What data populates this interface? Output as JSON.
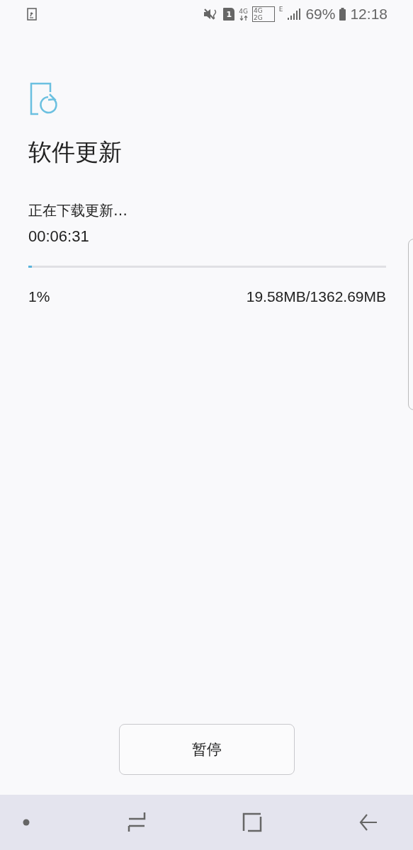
{
  "status_bar": {
    "sim_slot": "1",
    "network_type": "4G",
    "dual_top": "4G",
    "dual_bottom": "2G",
    "data_type": "E",
    "battery": "69%",
    "time": "12:18"
  },
  "title": "软件更新",
  "status_text": "正在下载更新…",
  "elapsed": "00:06:31",
  "progress": {
    "level": 0.01,
    "percent": "1%",
    "size": "19.58MB/1362.69MB"
  },
  "button": "暂停"
}
